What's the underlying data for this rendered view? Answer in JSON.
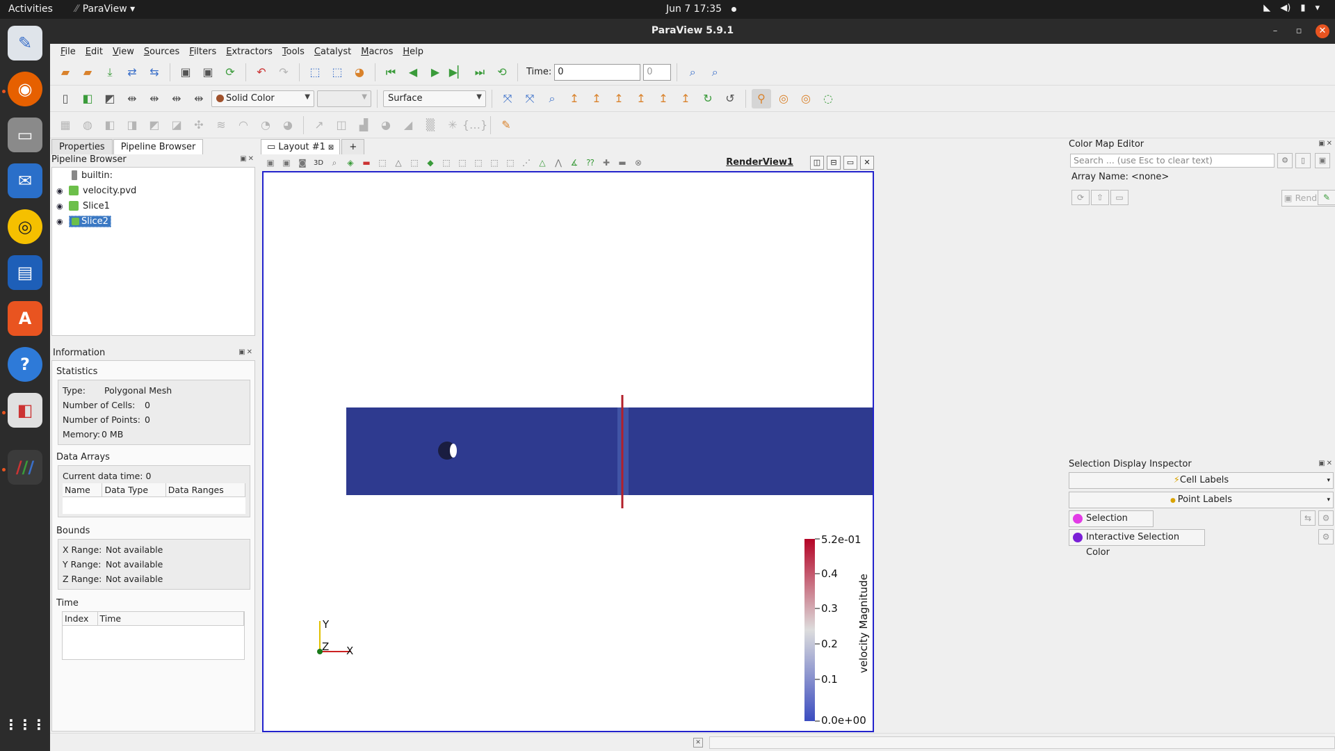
{
  "topbar": {
    "activities": "Activities",
    "app_name": "ParaView",
    "clock": "Jun 7  17:35"
  },
  "window": {
    "title": "ParaView 5.9.1"
  },
  "menu": [
    "File",
    "Edit",
    "View",
    "Sources",
    "Filters",
    "Extractors",
    "Tools",
    "Catalyst",
    "Macros",
    "Help"
  ],
  "toolbar": {
    "time_label": "Time:",
    "time_value": "0",
    "time_index": "0",
    "color_by": "Solid Color",
    "representation": "Surface"
  },
  "left": {
    "tabs": [
      "Properties",
      "Pipeline Browser"
    ],
    "pipeline_title": "Pipeline Browser",
    "pipeline_items": [
      "builtin:",
      "velocity.pvd",
      "Slice1",
      "Slice2"
    ],
    "info_title": "Information",
    "statistics_title": "Statistics",
    "type_label": "Type:",
    "type_value": "Polygonal Mesh",
    "cells_label": "Number of Cells:",
    "cells_value": "0",
    "points_label": "Number of Points:",
    "points_value": "0",
    "memory_label": "Memory:",
    "memory_value": "0 MB",
    "arrays_title": "Data Arrays",
    "current_time": "Current data time: 0",
    "array_cols": [
      "Name",
      "Data Type",
      "Data Ranges"
    ],
    "bounds_title": "Bounds",
    "x_range_label": "X Range:",
    "y_range_label": "Y Range:",
    "z_range_label": "Z Range:",
    "range_value": "Not available",
    "time_title": "Time",
    "time_cols": [
      "Index",
      "Time"
    ]
  },
  "center": {
    "layout_tab": "Layout #1",
    "plus": "+",
    "view_name": "RenderView1",
    "mode_3d": "3D",
    "axes": {
      "y": "Y",
      "z": "Z",
      "x": "X"
    },
    "colorbar": {
      "title": "velocity Magnitude",
      "max_label": "5.2e-01",
      "min_label": "0.0e+00",
      "ticks": [
        "0.4",
        "0.3",
        "0.2",
        "0.1"
      ]
    }
  },
  "right": {
    "cme_title": "Color Map Editor",
    "search_placeholder": "Search ... (use Esc to clear text)",
    "array_name": "Array Name: <none>",
    "render_views": "Render Views",
    "sdi_title": "Selection Display Inspector",
    "cell_labels": "Cell Labels",
    "point_labels": "Point Labels",
    "selection_color": "Selection Color",
    "interactive_selection_color": "Interactive Selection Color"
  },
  "colors": {
    "slice_blue": "#2e3a8f",
    "slice_red": "#b31f2a",
    "selection_magenta": "#e23ce6",
    "interactive_purple": "#7a1fd6",
    "view_border": "#2222cc"
  }
}
